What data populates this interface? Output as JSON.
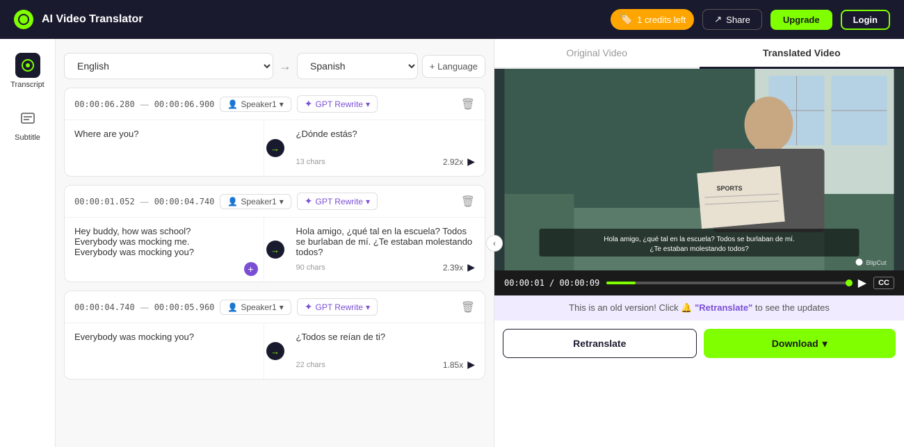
{
  "app": {
    "title": "AI Video Translator",
    "logo_symbol": "⬡"
  },
  "header": {
    "credits": "1 credits left",
    "share_label": "Share",
    "upgrade_label": "Upgrade",
    "login_label": "Login"
  },
  "sidebar": {
    "items": [
      {
        "label": "Transcript",
        "icon": "⬡",
        "active": true
      },
      {
        "label": "Subtitle",
        "icon": "T",
        "active": false
      }
    ]
  },
  "lang_bar": {
    "source_lang": "English",
    "target_lang": "Spanish",
    "add_language_label": "+ Language"
  },
  "cards": [
    {
      "id": 1,
      "time_start": "00:00:06.280",
      "time_end": "00:00:06.900",
      "speaker": "Speaker1",
      "gpt_label": "GPT Rewrite",
      "original_text": "Where are you?",
      "translated_text": "¿Dónde estás?",
      "char_count": "13 chars",
      "speed": "2.92x"
    },
    {
      "id": 2,
      "time_start": "00:00:01.052",
      "time_end": "00:00:04.740",
      "speaker": "Speaker1",
      "gpt_label": "GPT Rewrite",
      "original_text": "Hey buddy, how was school?\nEverybody was mocking me.\nEverybody was mocking you?",
      "translated_text": "Hola amigo, ¿qué tal en la escuela? Todos se burlaban de mí. ¿Te estaban molestando todos?",
      "char_count": "90 chars",
      "speed": "2.39x"
    },
    {
      "id": 3,
      "time_start": "00:00:04.740",
      "time_end": "00:00:05.960",
      "speaker": "Speaker1",
      "gpt_label": "GPT Rewrite",
      "original_text": "Everybody was mocking you?",
      "translated_text": "¿Todos se reían de ti?",
      "char_count": "22 chars",
      "speed": "1.85x"
    }
  ],
  "video_panel": {
    "tab_original": "Original Video",
    "tab_translated": "Translated Video",
    "active_tab": "translated",
    "subtitle_overlay": "Hola amigo, ¿qué tal en la escuela? Todos se burlaban de mí. ¿Te estaban molestando todos?",
    "watermark": "BlipCut",
    "time_current": "00:00:01",
    "time_total": "00:00:09",
    "progress_percent": 11,
    "cc_label": "CC",
    "banner_text_before": "This is an old version! Click",
    "banner_retranslate": "\"Retranslate\"",
    "banner_text_after": "to see the updates",
    "retranslate_btn": "Retranslate",
    "download_btn": "Download"
  }
}
